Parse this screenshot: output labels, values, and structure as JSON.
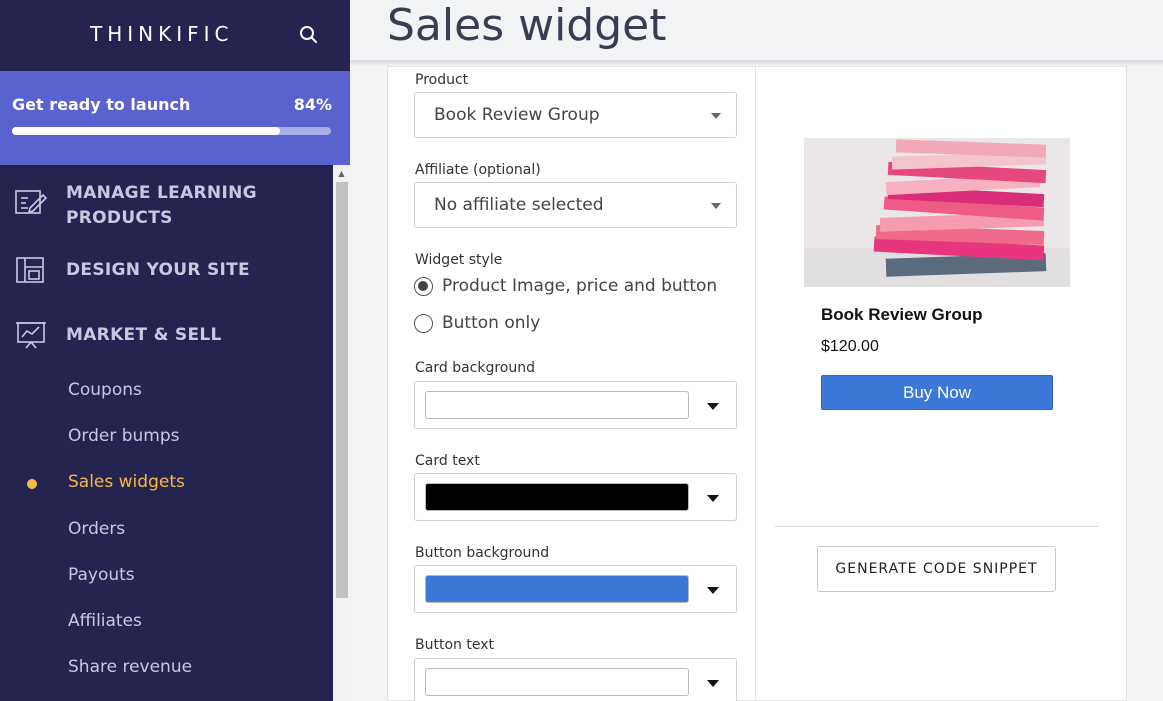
{
  "brand": {
    "logo_text": "THINKIFIC"
  },
  "launch": {
    "title": "Get ready to launch",
    "percent_label": "84%",
    "progress": 0.84
  },
  "nav": {
    "sections": [
      {
        "label": "MANAGE LEARNING PRODUCTS",
        "icon": "edit-list-icon"
      },
      {
        "label": "DESIGN YOUR SITE",
        "icon": "layout-icon"
      },
      {
        "label": "MARKET & SELL",
        "icon": "chart-board-icon"
      }
    ],
    "items": [
      {
        "label": "Coupons",
        "active": false
      },
      {
        "label": "Order bumps",
        "active": false
      },
      {
        "label": "Sales widgets",
        "active": true
      },
      {
        "label": "Orders",
        "active": false
      },
      {
        "label": "Payouts",
        "active": false
      },
      {
        "label": "Affiliates",
        "active": false
      },
      {
        "label": "Share revenue",
        "active": false
      }
    ]
  },
  "page": {
    "title": "Sales widget"
  },
  "form": {
    "product_label": "Product",
    "product_value": "Book Review Group",
    "affiliate_label": "Affiliate (optional)",
    "affiliate_value": "No affiliate selected",
    "widget_style_label": "Widget style",
    "style_options": [
      {
        "label": "Product Image, price and button",
        "checked": true
      },
      {
        "label": "Button only",
        "checked": false
      }
    ],
    "card_background_label": "Card background",
    "card_background_color": "#ffffff",
    "card_text_label": "Card text",
    "card_text_color": "#000000",
    "button_background_label": "Button background",
    "button_background_color": "#3b78d8",
    "button_text_label": "Button text",
    "button_text_color": "#ffffff"
  },
  "preview": {
    "product_name": "Book Review Group",
    "price": "$120.00",
    "buy_label": "Buy Now",
    "image_icon": "book-stack-image"
  },
  "actions": {
    "generate_label": "GENERATE CODE SNIPPET"
  },
  "colors": {
    "sidebar_bg": "#252450",
    "launch_bg": "#5a62cf",
    "active_nav": "#f5b94a",
    "accent_blue": "#3b78d8"
  }
}
